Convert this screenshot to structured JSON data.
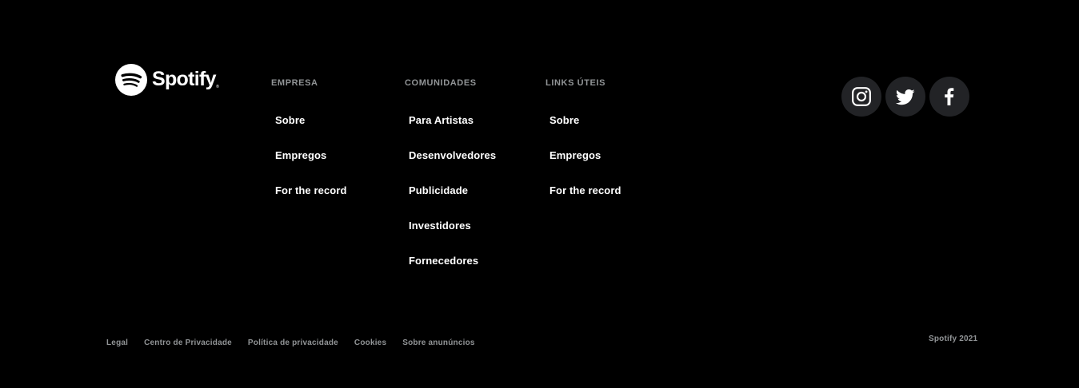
{
  "brand": {
    "name": "Spotify",
    "registered": "®",
    "logo_icon": "spotify-logo-icon"
  },
  "columns": [
    {
      "title": "Empresa",
      "links": [
        "Sobre",
        "Empregos",
        "For the record"
      ]
    },
    {
      "title": "Comunidades",
      "links": [
        "Para Artistas",
        "Desenvolvedores",
        "Publicidade",
        "Investidores",
        "Fornecedores"
      ]
    },
    {
      "title": "Links úteis",
      "links": [
        "Sobre",
        "Empregos",
        "For the record"
      ]
    }
  ],
  "social": [
    {
      "name": "instagram",
      "icon": "instagram-icon"
    },
    {
      "name": "twitter",
      "icon": "twitter-icon"
    },
    {
      "name": "facebook",
      "icon": "facebook-icon"
    }
  ],
  "legal_links": [
    "Legal",
    "Centro de Privacidade",
    "Política de privacidade",
    "Cookies",
    "Sobre anunúncios"
  ],
  "copyright": "Spotify 2021",
  "colors": {
    "background": "#000000",
    "heading": "#919496",
    "link": "#ffffff",
    "social_bg": "#222326"
  }
}
